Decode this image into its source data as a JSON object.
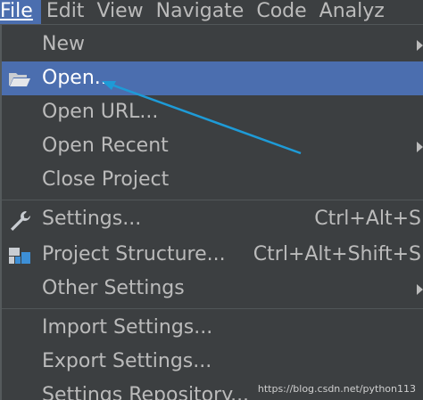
{
  "menubar": {
    "items": [
      {
        "label": "File",
        "active": true
      },
      {
        "label": "Edit"
      },
      {
        "label": "View"
      },
      {
        "label": "Navigate"
      },
      {
        "label": "Code"
      },
      {
        "label": "Analyz"
      }
    ]
  },
  "menu": {
    "new": {
      "label": "New"
    },
    "open": {
      "label": "Open..."
    },
    "open_url": {
      "label": "Open URL..."
    },
    "open_recent": {
      "label": "Open Recent"
    },
    "close_project": {
      "label": "Close Project"
    },
    "settings": {
      "label": "Settings...",
      "shortcut": "Ctrl+Alt+S"
    },
    "project_structure": {
      "label": "Project Structure...",
      "shortcut": "Ctrl+Alt+Shift+S"
    },
    "other_settings": {
      "label": "Other Settings"
    },
    "import_settings": {
      "label": "Import Settings..."
    },
    "export_settings": {
      "label": "Export Settings..."
    },
    "settings_repository": {
      "label": "Settings Repository..."
    }
  },
  "icons": {
    "open": "folder-open-icon",
    "settings": "wrench-icon",
    "project_structure": "project-structure-icon"
  },
  "watermark": "https://blog.csdn.net/python113",
  "colors": {
    "background": "#3c3f41",
    "selection": "#4b6eaf",
    "text": "#bbbbbb",
    "annotation_arrow": "#1e9bd7"
  }
}
